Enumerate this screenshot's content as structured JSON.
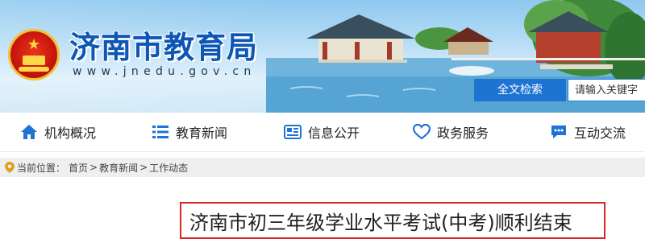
{
  "header": {
    "site_title": "济南市教育局",
    "site_url": "www.jnedu.gov.cn",
    "emblem_icon": "national-emblem-icon",
    "search": {
      "button_label": "全文检索",
      "placeholder": "请输入关键字"
    }
  },
  "nav": {
    "items": [
      {
        "label": "机构概况",
        "icon": "home-icon"
      },
      {
        "label": "教育新闻",
        "icon": "list-icon"
      },
      {
        "label": "信息公开",
        "icon": "newspaper-icon"
      },
      {
        "label": "政务服务",
        "icon": "heart-icon"
      },
      {
        "label": "互动交流",
        "icon": "chat-icon"
      }
    ]
  },
  "breadcrumb": {
    "prefix": "当前位置：",
    "items": [
      "首页",
      "教育新闻",
      "工作动态"
    ],
    "separator": ">"
  },
  "article": {
    "title": "济南市初三年级学业水平考试(中考)顺利结束"
  },
  "colors": {
    "brand_blue": "#1f74d2",
    "title_blue": "#0d56b5",
    "highlight_red": "#d6262a",
    "emblem_red": "#c8150c",
    "gold": "#f1c232"
  }
}
